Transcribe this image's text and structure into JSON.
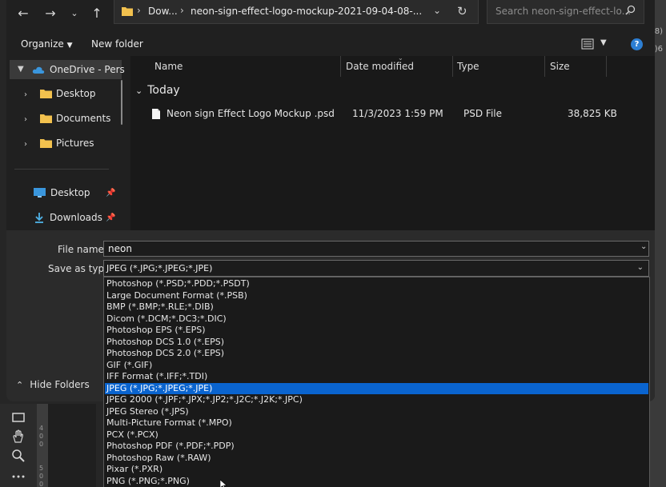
{
  "address": {
    "crumbs": [
      "Dow...",
      "neon-sign-effect-logo-mockup-2021-09-04-08-..."
    ]
  },
  "search": {
    "placeholder": "Search neon-sign-effect-lo..."
  },
  "toolbar": {
    "organize": "Organize",
    "new_folder": "New folder"
  },
  "nav_pane": {
    "items": [
      {
        "label": "OneDrive - Pers",
        "icon": "cloud-icon"
      },
      {
        "label": "Desktop",
        "icon": "folder-icon"
      },
      {
        "label": "Documents",
        "icon": "folder-icon"
      },
      {
        "label": "Pictures",
        "icon": "folder-icon"
      },
      {
        "label": "Desktop",
        "icon": "desktop-icon"
      },
      {
        "label": "Downloads",
        "icon": "download-icon"
      }
    ]
  },
  "columns": {
    "name": "Name",
    "date": "Date modified",
    "type": "Type",
    "size": "Size"
  },
  "group_label": "Today",
  "files": [
    {
      "name": "Neon sign Effect Logo Mockup .psd",
      "date": "11/3/2023 1:59 PM",
      "type": "PSD File",
      "size": "38,825 KB"
    }
  ],
  "form": {
    "file_name_label": "File name:",
    "file_name_value": "neon",
    "save_type_label": "Save as type:",
    "save_type_value": "JPEG (*.JPG;*.JPEG;*.JPE)",
    "hide_folders": "Hide Folders"
  },
  "dropdown_options": [
    "Photoshop (*.PSD;*.PDD;*.PSDT)",
    "Large Document Format (*.PSB)",
    "BMP (*.BMP;*.RLE;*.DIB)",
    "Dicom (*.DCM;*.DC3;*.DIC)",
    "Photoshop EPS (*.EPS)",
    "Photoshop DCS 1.0 (*.EPS)",
    "Photoshop DCS 2.0 (*.EPS)",
    "GIF (*.GIF)",
    "IFF Format (*.IFF;*.TDI)",
    "JPEG (*.JPG;*.JPEG;*.JPE)",
    "JPEG 2000 (*.JPF;*.JPX;*.JP2;*.J2C;*.J2K;*.JPC)",
    "JPEG Stereo (*.JPS)",
    "Multi-Picture Format (*.MPO)",
    "PCX (*.PCX)",
    "Photoshop PDF (*.PDF;*.PDP)",
    "Photoshop Raw (*.RAW)",
    "Pixar (*.PXR)",
    "PNG (*.PNG;*.PNG)"
  ],
  "selected_option_index": 9,
  "ruler_labels": [
    "4",
    "0",
    "0",
    "5",
    "0",
    "0"
  ],
  "ps_side": {
    "a": ")8)",
    "b": ")6"
  },
  "colors": {
    "accent": "#0a64cf",
    "folder": "#f2c14e",
    "onedrive": "#3a96dd"
  }
}
